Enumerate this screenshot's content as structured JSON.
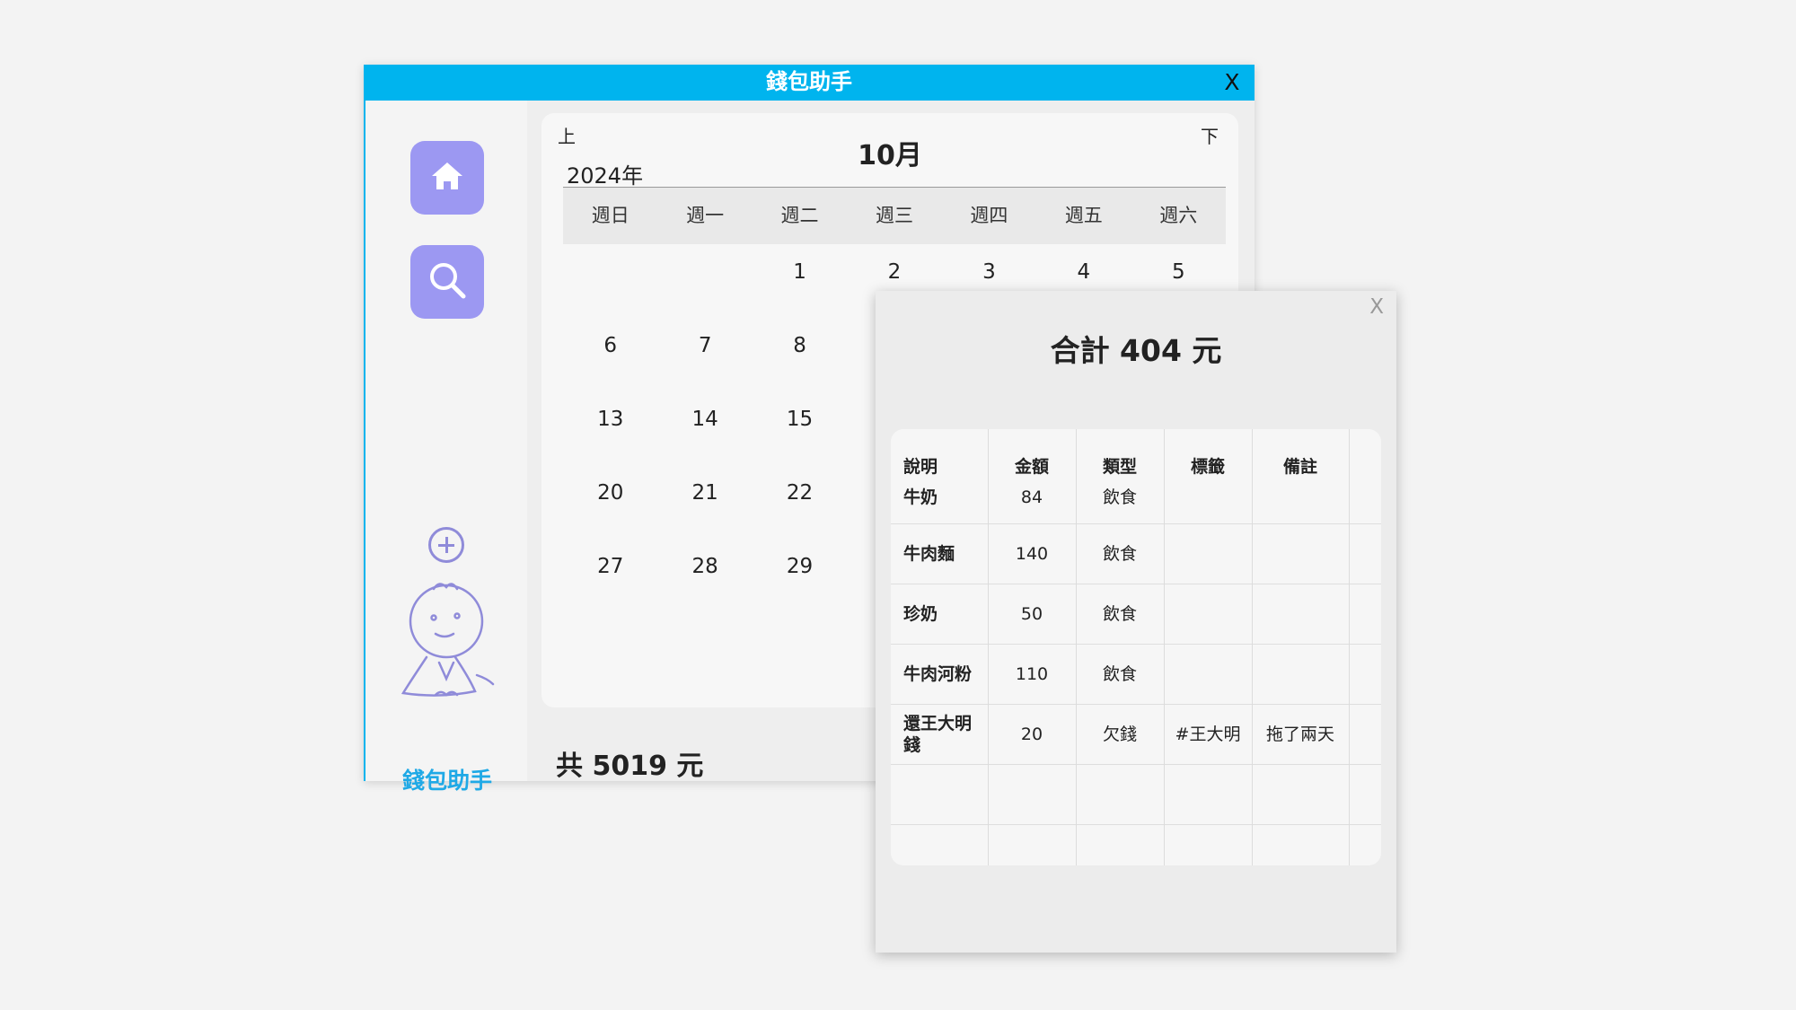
{
  "app": {
    "title": "錢包助手",
    "close_label": "X"
  },
  "sidebar": {
    "home_icon": "home-icon",
    "search_icon": "search-icon",
    "add_icon": "plus-circle-icon",
    "app_name": "錢包助手"
  },
  "calendar": {
    "prev_label": "上",
    "next_label": "下",
    "month": "10月",
    "year": "2024年",
    "weekdays": [
      "週日",
      "週一",
      "週二",
      "週三",
      "週四",
      "週五",
      "週六"
    ],
    "days": [
      "",
      "",
      "1",
      "2",
      "3",
      "4",
      "5",
      "6",
      "7",
      "8",
      "",
      "",
      "",
      "",
      "13",
      "14",
      "15",
      "",
      "",
      "",
      "",
      "20",
      "21",
      "22",
      "",
      "",
      "",
      "",
      "27",
      "28",
      "29",
      "",
      "",
      "",
      ""
    ],
    "total": "共 5019 元"
  },
  "popup": {
    "close_label": "X",
    "total": "合計 404 元",
    "columns": [
      "說明",
      "金額",
      "類型",
      "標籤",
      "備註"
    ],
    "rows": [
      {
        "desc": "牛奶",
        "amount": "84",
        "type": "飲食",
        "tag": "",
        "note": ""
      },
      {
        "desc": "牛肉麵",
        "amount": "140",
        "type": "飲食",
        "tag": "",
        "note": ""
      },
      {
        "desc": "珍奶",
        "amount": "50",
        "type": "飲食",
        "tag": "",
        "note": ""
      },
      {
        "desc": "牛肉河粉",
        "amount": "110",
        "type": "飲食",
        "tag": "",
        "note": ""
      },
      {
        "desc": "還王大明錢",
        "amount": "20",
        "type": "欠錢",
        "tag": "#王大明",
        "note": "拖了兩天"
      }
    ]
  },
  "colors": {
    "titlebar": "#00b4ee",
    "button": "#9c98f2",
    "accent_text": "#1fa9e6"
  }
}
